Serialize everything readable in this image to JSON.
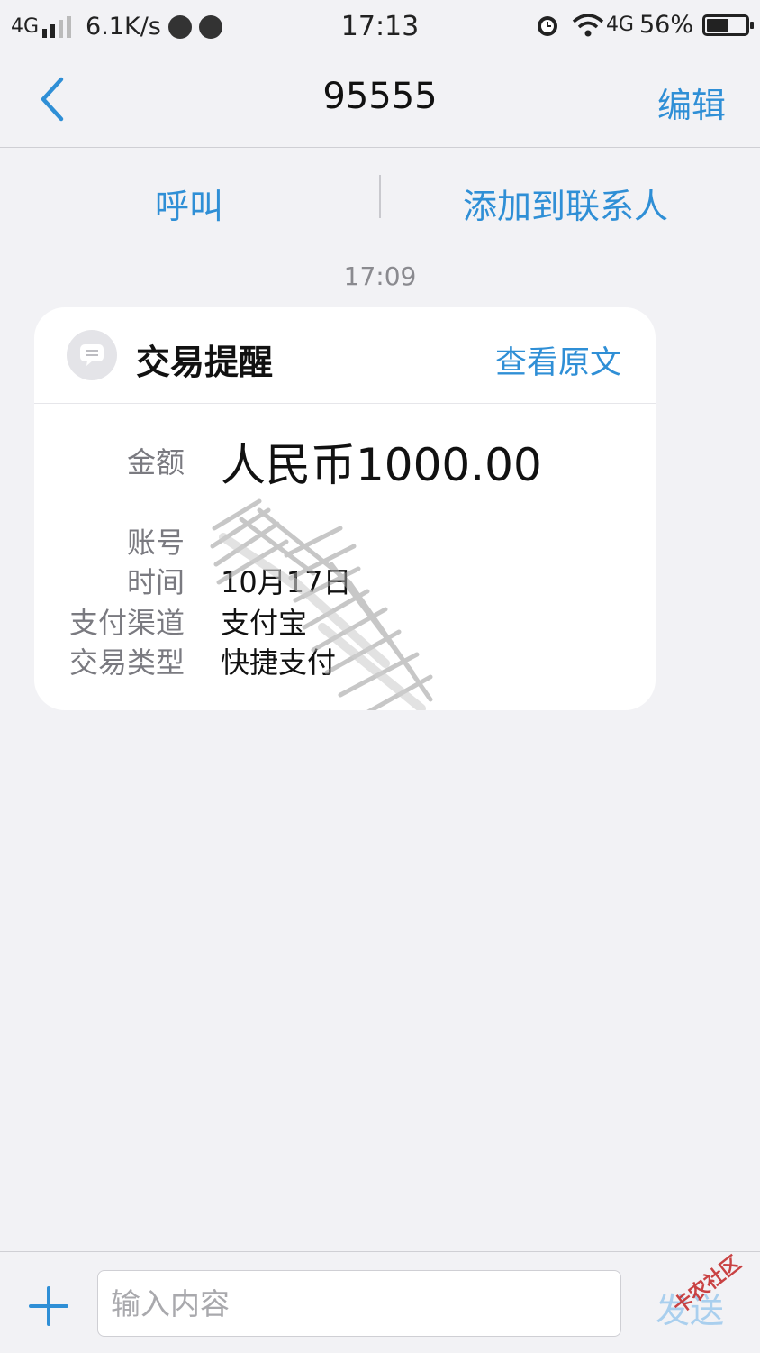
{
  "status_bar": {
    "network": "4G",
    "speed": "6.1K/s",
    "time": "17:13",
    "right_network": "4G",
    "battery": "56%",
    "battery_level": 0.56
  },
  "nav": {
    "title": "95555",
    "edit": "编辑"
  },
  "actions": {
    "call": "呼叫",
    "add_contact": "添加到联系人"
  },
  "message": {
    "time": "17:09",
    "card": {
      "title": "交易提醒",
      "view_original": "查看原文",
      "fields": {
        "amount": {
          "label": "金额",
          "value": "人民币1000.00"
        },
        "account": {
          "label": "账号",
          "value": ""
        },
        "time": {
          "label": "时间",
          "value": "10月17日"
        },
        "channel": {
          "label": "支付渠道",
          "value": "支付宝"
        },
        "type": {
          "label": "交易类型",
          "value": "快捷支付"
        }
      }
    }
  },
  "composer": {
    "placeholder": "输入内容",
    "send": "发送"
  },
  "watermark": "卡农社区",
  "colors": {
    "accent": "#2f8fd6",
    "background": "#f2f2f5",
    "card": "#ffffff",
    "muted": "#8a8a8f"
  }
}
